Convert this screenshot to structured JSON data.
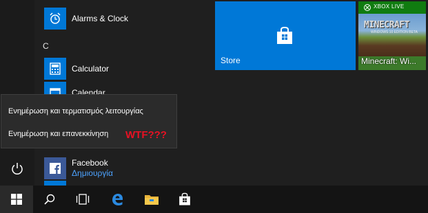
{
  "applist": {
    "alarms": {
      "label": "Alarms & Clock",
      "icon": "alarm-clock-icon"
    },
    "group_letter": "C",
    "calculator": {
      "label": "Calculator",
      "icon": "calculator-icon"
    },
    "calendar": {
      "label": "Calendar",
      "icon": "calendar-icon"
    },
    "facebook": {
      "label": "Facebook",
      "sublabel": "Δημιουργία",
      "icon": "facebook-icon"
    }
  },
  "tiles": {
    "store": {
      "label": "Store",
      "icon": "store-bag-icon",
      "color": "#0078d7"
    },
    "minecraft": {
      "label": "Minecraft: Wi...",
      "badge": "XBOX LIVE",
      "logo": "MINECRAFT",
      "logo_sub": "WINDOWS 10 EDITION BETA"
    }
  },
  "power_menu": {
    "items": [
      "Ενημέρωση και τερματισμός λειτουργίας",
      "Ενημέρωση και επανεκκίνηση"
    ],
    "annotation": "WTF???"
  },
  "colors": {
    "accent": "#0078d7",
    "annotation": "#e81123",
    "link": "#4da3ff"
  },
  "taskbar": {
    "items": [
      "start-icon",
      "search-icon",
      "task-view-icon",
      "edge-icon",
      "file-explorer-icon",
      "store-icon"
    ]
  }
}
